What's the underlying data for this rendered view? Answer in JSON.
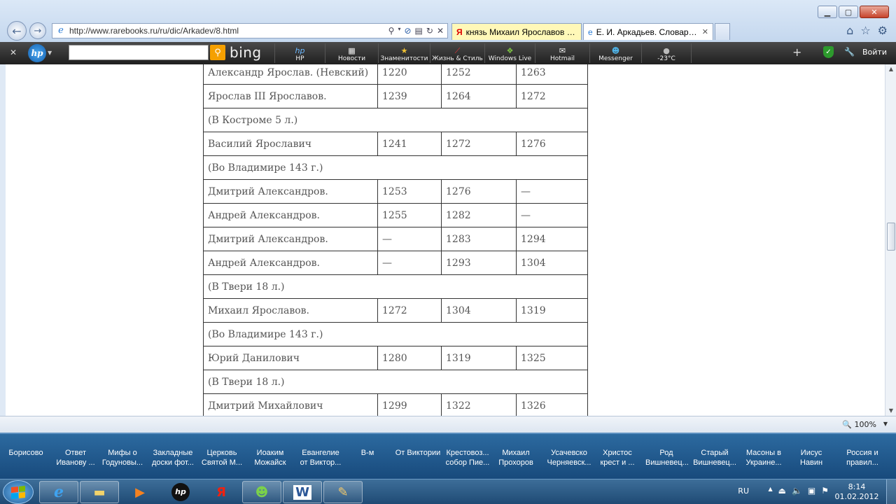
{
  "browser": {
    "address_url": "http://www.rarebooks.ru/ru/dic/Arkadev/8.html",
    "tabs": [
      {
        "title": "князь Михаил Ярославов Тве...",
        "icon": "Я"
      },
      {
        "title": "Е. И. Аркадьев. Словарь б...",
        "icon": "e"
      }
    ],
    "zoom": "100%"
  },
  "hp_toolbar": {
    "search_engine": "bing",
    "items": [
      {
        "label": "HP",
        "icon": "hp"
      },
      {
        "label": "Новости",
        "icon": "news-icon"
      },
      {
        "label": "Знаменитости",
        "icon": "star-icon"
      },
      {
        "label": "Жизнь & Стиль",
        "icon": "heels-icon"
      },
      {
        "label": "Windows Live",
        "icon": "windows-icon"
      },
      {
        "label": "Hotmail",
        "icon": "mail-icon"
      },
      {
        "label": "Messenger",
        "icon": "messenger-icon"
      },
      {
        "label": "-23°C",
        "icon": "weather-icon"
      }
    ],
    "login": "Войти"
  },
  "table": {
    "rows": [
      {
        "name": "Александр Ярослав. (Невский)",
        "a": "1220",
        "b": "1252",
        "c": "1263"
      },
      {
        "name": "Ярослав III Ярославов.",
        "a": "1239",
        "b": "1264",
        "c": "1272"
      },
      {
        "note": "(В Костроме 5 л.)",
        "indent": true
      },
      {
        "name": "Василий Ярославич",
        "a": "1241",
        "b": "1272",
        "c": "1276"
      },
      {
        "note": "(Во Владимире 143 г.)",
        "indent": false
      },
      {
        "name": "Дмитрий Александров.",
        "a": "1253",
        "b": "1276",
        "c": "—"
      },
      {
        "name": "Андрей Александров.",
        "a": "1255",
        "b": "1282",
        "c": "—"
      },
      {
        "name": "Дмитрий Александров.",
        "a": "—",
        "b": "1283",
        "c": "1294"
      },
      {
        "name": "Андрей Александров.",
        "a": "—",
        "b": "1293",
        "c": "1304"
      },
      {
        "note": "(В Твери 18 л.)",
        "indent": false
      },
      {
        "name": "Михаил Ярославов.",
        "a": "1272",
        "b": "1304",
        "c": "1319"
      },
      {
        "note": "(Во Владимире 143 г.)",
        "indent": true
      },
      {
        "name": "Юрий Данилович",
        "a": "1280",
        "b": "1319",
        "c": "1325"
      },
      {
        "note": "(В Твери 18 л.)",
        "indent": true
      },
      {
        "name": "Дмитрий Михайлович",
        "a": "1299",
        "b": "1322",
        "c": "1326"
      }
    ]
  },
  "links_bar": [
    "Борисово",
    "Ответ\nИванову ...",
    "Мифы о\nГодуновы...",
    "Закладные\nдоски фот...",
    "Церковь\nСвятой М...",
    "Иоаким\nМожайск",
    "Евангелие\nот Виктор...",
    "В-м",
    "От Виктории",
    "Крестовоз...\nсобор Пие...",
    "Михаил\nПрохоров",
    "Усачевско\nЧерняевск...",
    "Христос\nкрест и ...",
    "Род\nВишневец...",
    "Старый\nВишневец...",
    "Масоны в\nУкраине...",
    "Иисус\nНавин",
    "Россия и\nправил..."
  ],
  "taskbar": {
    "apps": [
      "internet-explorer",
      "file-explorer",
      "media-player",
      "hp",
      "yandex",
      "messenger",
      "word",
      "paint"
    ],
    "language": "RU",
    "time": "8:14",
    "date": "01.02.2012"
  }
}
